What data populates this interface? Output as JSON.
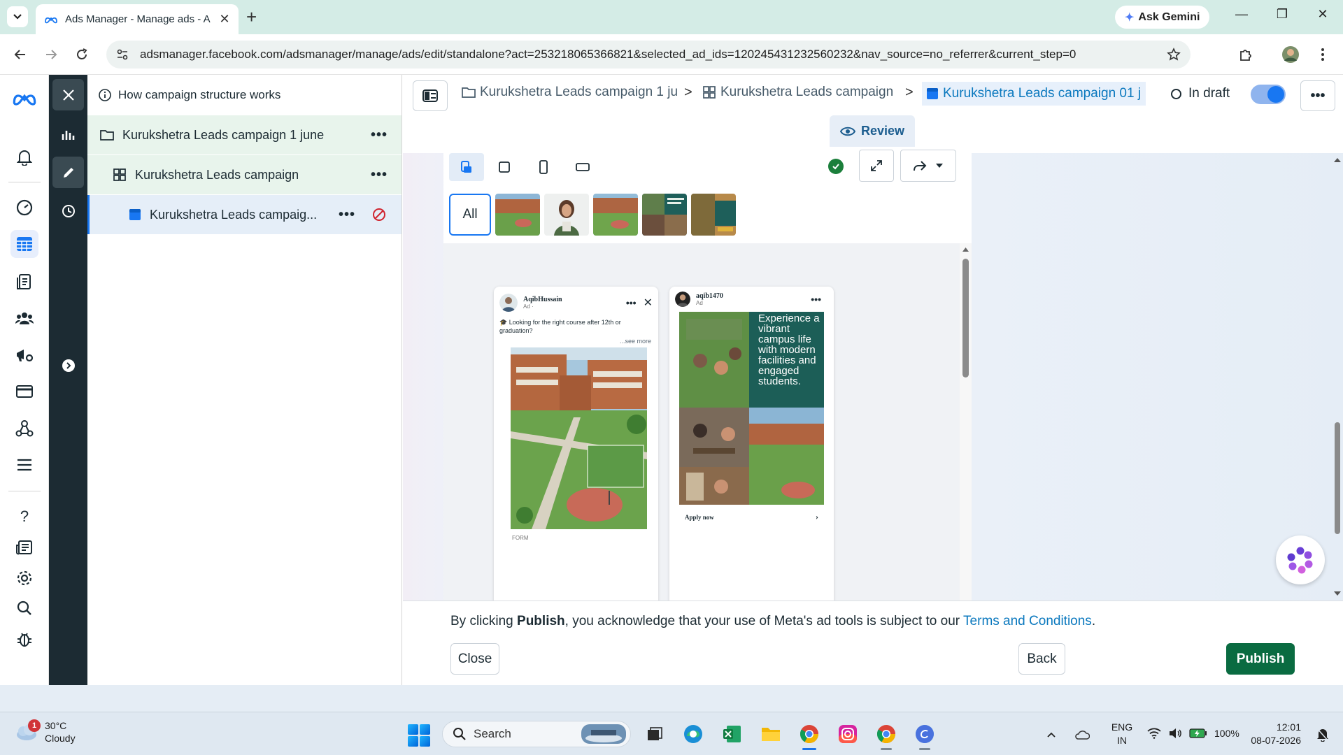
{
  "browser": {
    "tab_title": "Ads Manager - Manage ads - A",
    "new_tab_symbol": "+",
    "ask_gemini": "Ask Gemini",
    "url_domain": "adsmanager.facebook.com",
    "url_path": "/adsmanager/manage/ads/edit/standalone?act=253218065366821&selected_ad_ids=120245431232560232&nav_source=no_referrer&current_step=0"
  },
  "tree": {
    "header": "How campaign structure works",
    "campaign": "Kurukshetra Leads campaign 1 june",
    "adset": "Kurukshetra Leads campaign",
    "ad": "Kurukshetra Leads campaig...",
    "more_symbol": "•••"
  },
  "breadcrumbs": {
    "campaign": "Kurukshetra Leads campaign 1 ju",
    "adset": "Kurukshetra Leads campaign",
    "ad": "Kurukshetra Leads campaign 01 j",
    "separator": ">"
  },
  "status": {
    "label": "In draft",
    "more_symbol": "•••"
  },
  "review_tab": "Review",
  "preview": {
    "all_chip": "All",
    "card1": {
      "name": "AqibHussain",
      "sub": "Ad · ",
      "body": "🎓 Looking for the right course after 12th or graduation?",
      "see_more": "...see more",
      "footer": "FORM"
    },
    "card2": {
      "name": "aqib1470",
      "sub": "Ad",
      "headline": "Experience a vibrant campus life with modern facilities and engaged students.",
      "cta": "Apply now"
    }
  },
  "footer": {
    "terms_prefix": "By clicking ",
    "terms_bold": "Publish",
    "terms_middle": ", you acknowledge that your use of Meta's ad tools is subject to our ",
    "terms_link": "Terms and Conditions",
    "terms_suffix": ".",
    "close": "Close",
    "back": "Back",
    "publish": "Publish"
  },
  "taskbar": {
    "weather_temp": "30°C",
    "weather_desc": "Cloudy",
    "weather_badge": "1",
    "search": "Search",
    "lang_1": "ENG",
    "lang_2": "IN",
    "battery": "100%",
    "time": "12:01",
    "date": "08-07-2026"
  },
  "colors": {
    "publish": "#0a6b41",
    "brand_blue": "#1877f2",
    "toolstrip": "#1c2b33"
  }
}
